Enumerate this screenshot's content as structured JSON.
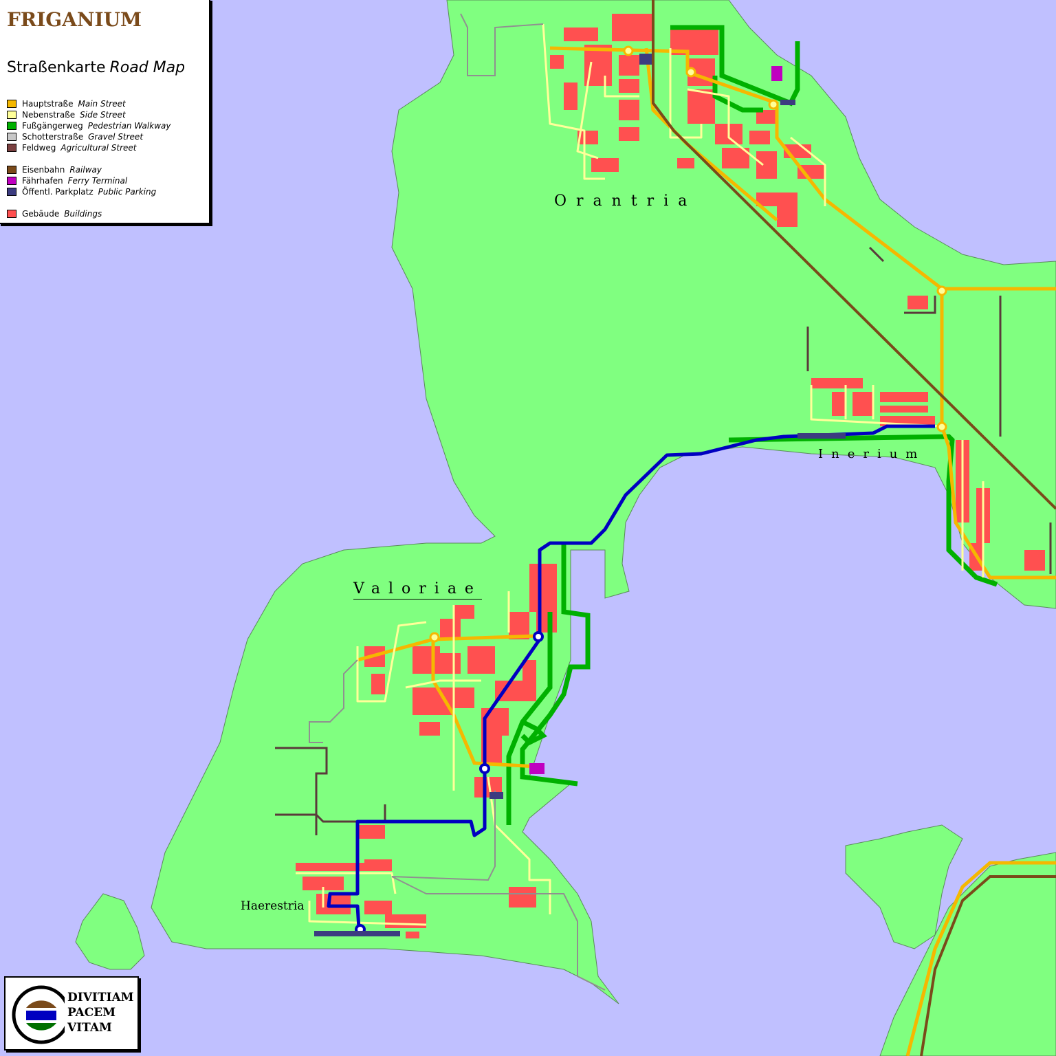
{
  "legend": {
    "title": "FRIGANIUM",
    "subtitle_de": "Straßenkarte",
    "subtitle_en": "Road Map",
    "items": [
      {
        "de": "Hauptstraße",
        "en": "Main Street",
        "color": "#f5b800"
      },
      {
        "de": "Nebenstraße",
        "en": "Side Street",
        "color": "#ffff99"
      },
      {
        "de": "Fußgängerweg",
        "en": "Pedestrian Walkway",
        "color": "#00b000"
      },
      {
        "de": "Schotterstraße",
        "en": "Gravel Street",
        "color": "#c8c8c8"
      },
      {
        "de": "Feldweg",
        "en": "Agricultural Street",
        "color": "#7a4040"
      },
      {
        "de": "Eisenbahn",
        "en": "Railway",
        "color": "#7a4a1a"
      },
      {
        "de": "Fährhafen",
        "en": "Ferry Terminal",
        "color": "#c000c0"
      },
      {
        "de": "Öffentl. Parkplatz",
        "en": "Public Parking",
        "color": "#3c3c80"
      },
      {
        "de": "Gebäude",
        "en": "Buildings",
        "color": "#ff5050"
      }
    ]
  },
  "places": {
    "orantria": "Orantria",
    "inerium": "Inerium",
    "valoriae": "Valoriae",
    "haerestria": "Haerestria"
  },
  "motto": [
    "DIVITIAM",
    "PACEM",
    "VITAM"
  ],
  "colors": {
    "water": "#c0c0ff",
    "land": "#80ff80",
    "building": "#ff5050",
    "main_street": "#f5b800",
    "side_street": "#ffff99",
    "walkway": "#00b000",
    "gravel": "#909090",
    "agri": "#5a3a3a",
    "railway": "#7a4a1a",
    "metro": "#0000c0",
    "ferry": "#c000c0",
    "parking": "#3c3c80"
  }
}
